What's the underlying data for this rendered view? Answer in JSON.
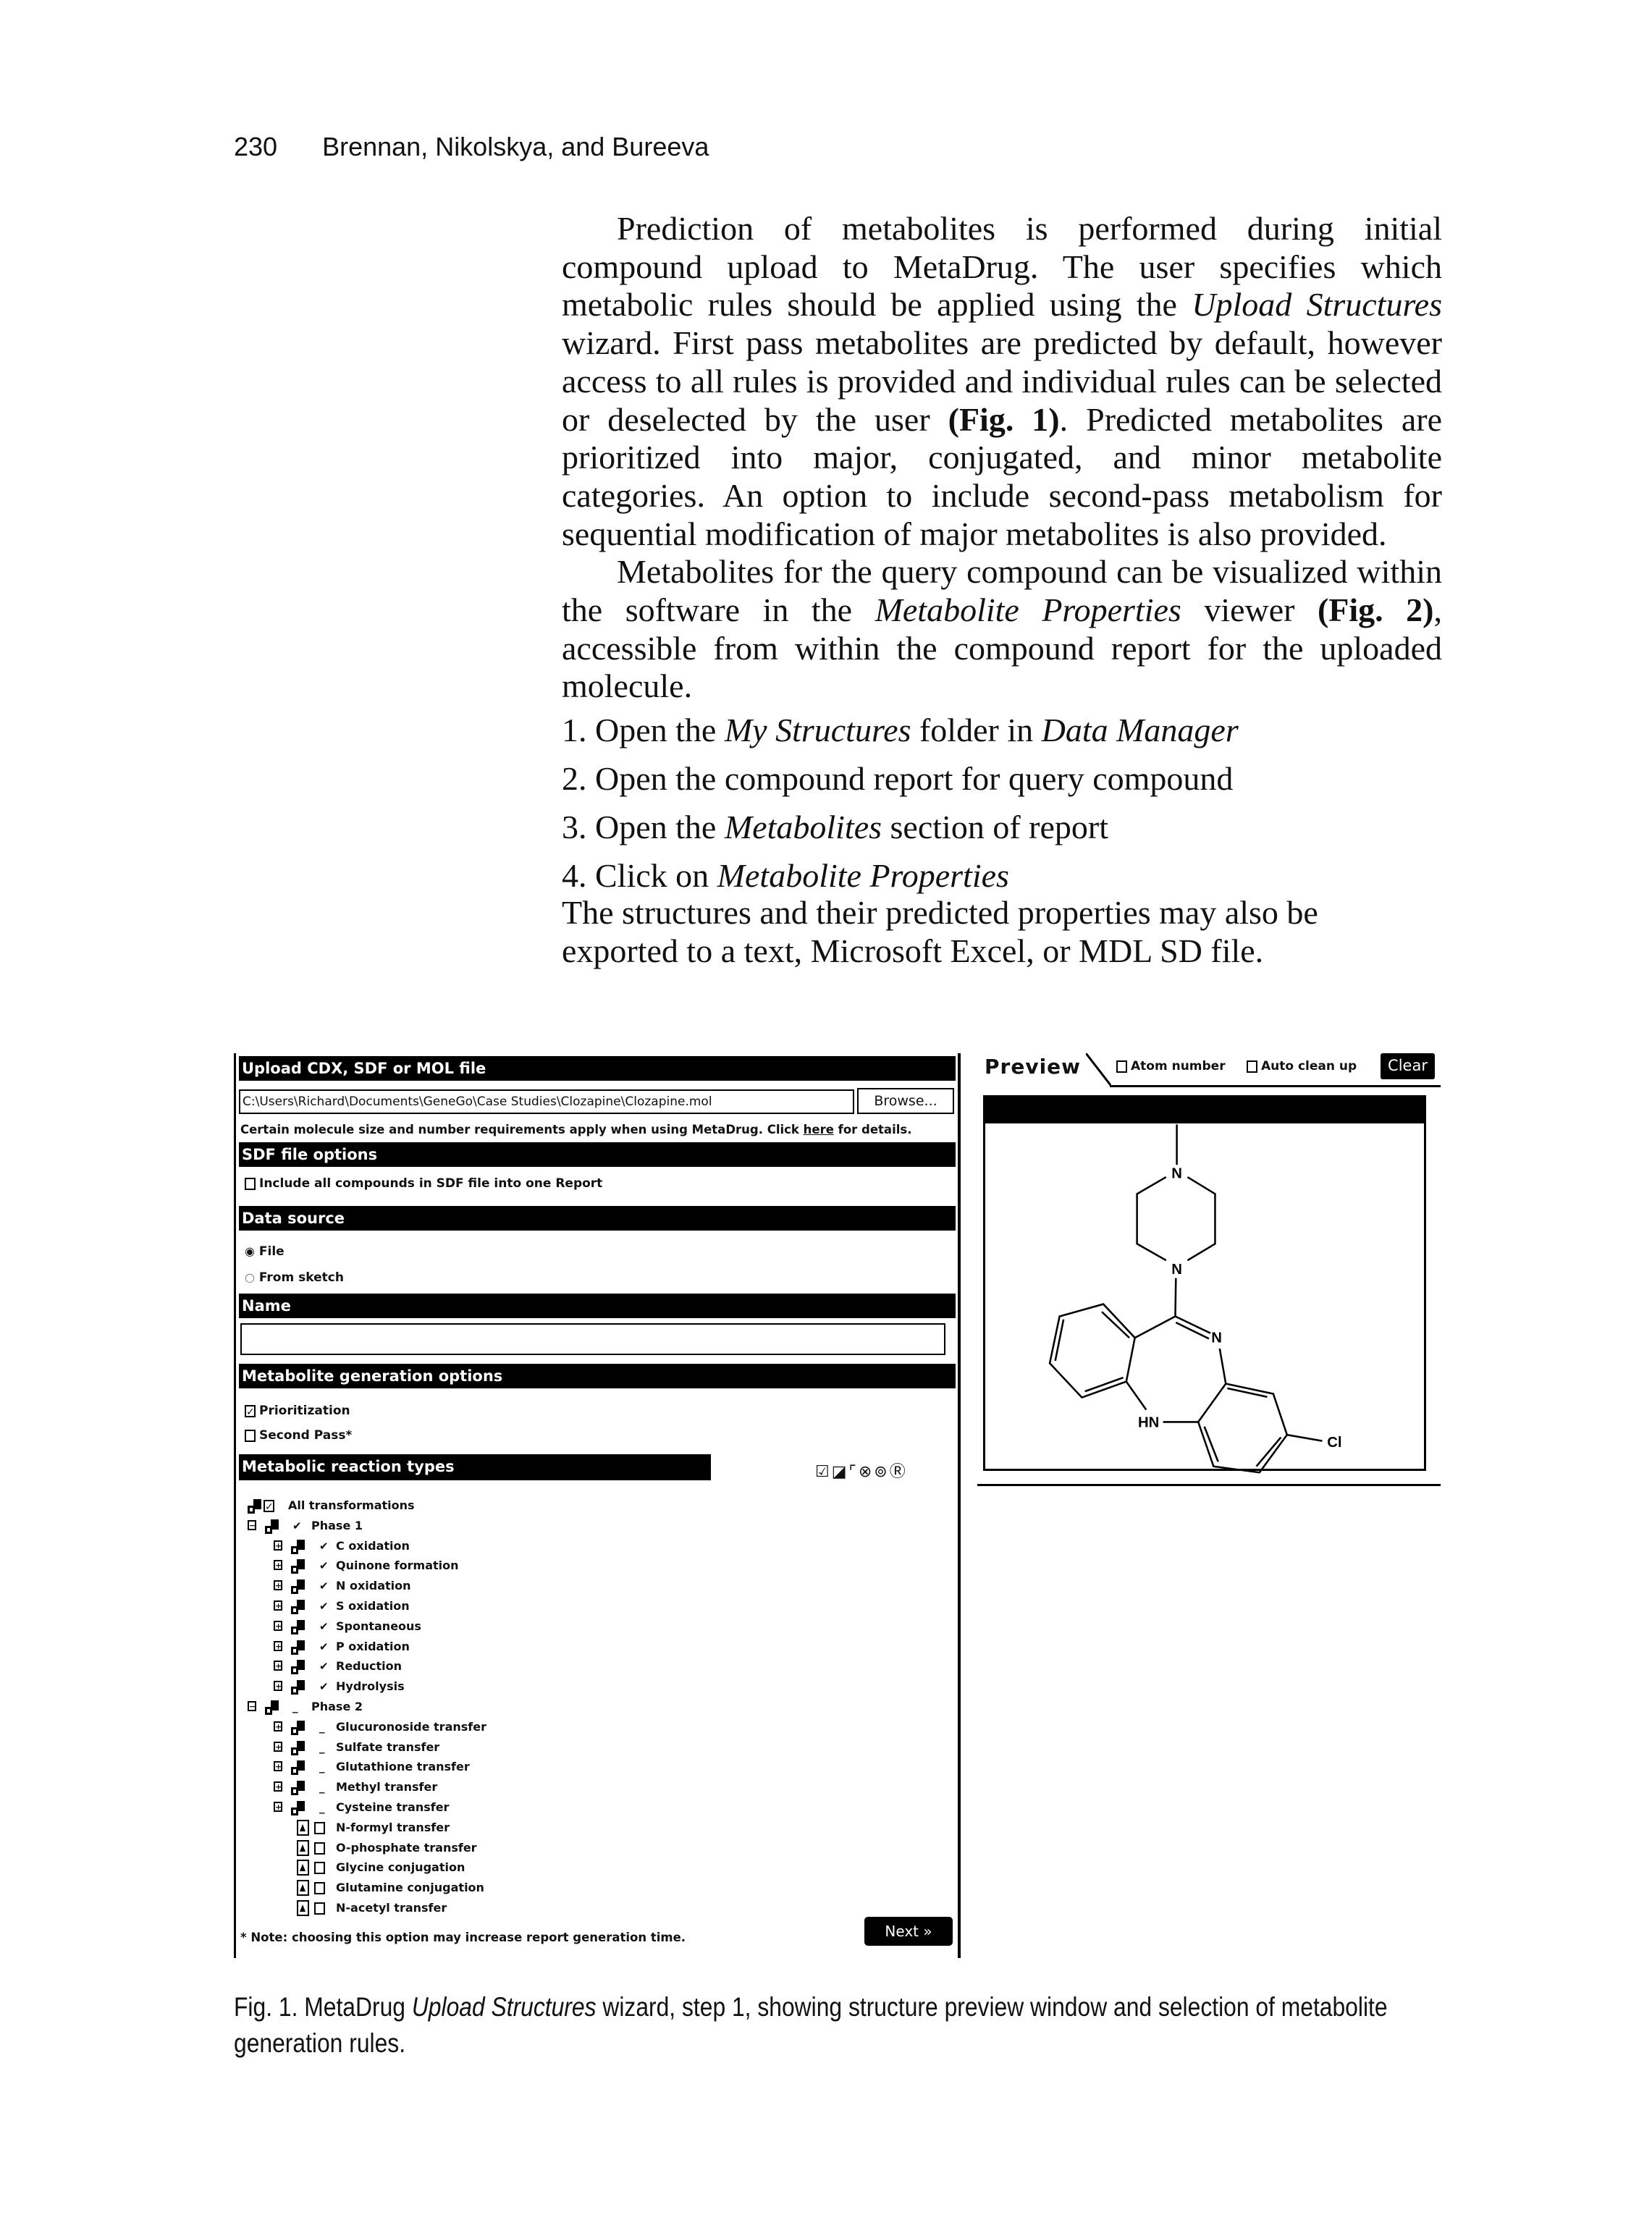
{
  "running_head": {
    "page_number": "230",
    "authors": "Brennan, Nikolskya, and Bureeva"
  },
  "body": {
    "p1": {
      "t1": "Prediction of metabolites is performed during initial compound upload to MetaDrug. The user specifies which metabolic rules should be applied using the ",
      "i1": "Upload Structures",
      "t2": " wizard. First pass metabolites are predicted by default, however access to all rules is provided and individual rules can be selected or deselected by the user ",
      "b1": "(Fig. 1)",
      "t3": ". Predicted metabolites are prioritized into major, conjugated, and minor metabolite categories. An option to include second-pass metabolism for sequential modification of major metabolites is also provided."
    },
    "p2": {
      "t1": "Metabolites for the query compound can be visualized within the software in the ",
      "i1": "Metabolite Properties",
      "t2": " viewer ",
      "b1": "(Fig. 2)",
      "t3": ", accessible from within the compound report for the uploaded molecule."
    },
    "steps": [
      {
        "pre": "1. Open the ",
        "em": "My Structures",
        "mid": " folder in ",
        "em2": "Data Manager"
      },
      {
        "pre": "2. Open the compound report for query compound",
        "em": "",
        "mid": "",
        "em2": ""
      },
      {
        "pre": "3. Open the ",
        "em": "Metabolites",
        "mid": " section of report",
        "em2": ""
      },
      {
        "pre": "4. Click on ",
        "em": "Metabolite Properties",
        "mid": "",
        "em2": ""
      }
    ],
    "p3": "The structures and their predicted properties may also be exported to a text, Microsoft Excel, or MDL SD file."
  },
  "wizard": {
    "upload_header": "Upload CDX, SDF or MOL file",
    "file_path": "C:\\Users\\Richard\\Documents\\GeneGo\\Case Studies\\Clozapine\\Clozapine.mol",
    "browse_label": "Browse...",
    "requirements_text": "Certain molecule size and number requirements apply when using MetaDrug. Click ",
    "here_link": "here",
    "requirements_tail": " for details.",
    "sdf_header": "SDF file options",
    "sdf_checkbox": "Include all compounds in SDF file into one Report",
    "data_source_header": "Data source",
    "radio_file": "File",
    "radio_sketch": "From sketch",
    "name_header": "Name",
    "name_value": "",
    "metabolite_header": "Metabolite generation options",
    "prioritization": "Prioritization",
    "second_pass": "Second Pass*",
    "reaction_header": "Metabolic reaction types",
    "tree": [
      {
        "label": "All transformations",
        "state": "checked"
      },
      {
        "label": "Phase 1",
        "state": "checked"
      },
      {
        "label": "C oxidation",
        "state": "checked"
      },
      {
        "label": "Quinone formation",
        "state": "checked"
      },
      {
        "label": "N oxidation",
        "state": "checked"
      },
      {
        "label": "S oxidation",
        "state": "checked"
      },
      {
        "label": "Spontaneous",
        "state": "checked"
      },
      {
        "label": "P oxidation",
        "state": "checked"
      },
      {
        "label": "Reduction",
        "state": "checked"
      },
      {
        "label": "Hydrolysis",
        "state": "checked"
      },
      {
        "label": "Phase 2",
        "state": "unchecked"
      },
      {
        "label": "Glucuronoside transfer",
        "state": "unchecked"
      },
      {
        "label": "Sulfate transfer",
        "state": "unchecked"
      },
      {
        "label": "Glutathione transfer",
        "state": "unchecked"
      },
      {
        "label": "Methyl transfer",
        "state": "unchecked"
      },
      {
        "label": "Cysteine transfer",
        "state": "unchecked"
      },
      {
        "label": "N-formyl transfer",
        "state": "unchecked"
      },
      {
        "label": "O-phosphate transfer",
        "state": "unchecked"
      },
      {
        "label": "Glycine conjugation",
        "state": "unchecked"
      },
      {
        "label": "Glutamine conjugation",
        "state": "unchecked"
      },
      {
        "label": "N-acetyl transfer",
        "state": "unchecked"
      }
    ],
    "note": "* Note: choosing this option may increase report generation time.",
    "next_label": "Next »"
  },
  "preview": {
    "tab_label": "Preview",
    "atom_number": "Atom number",
    "auto_clean": "Auto clean up",
    "clear_label": "Clear",
    "atoms": {
      "n1": "N",
      "n2": "N",
      "n3": "N",
      "hn": "HN",
      "cl": "Cl"
    }
  },
  "caption": {
    "prefix": "Fig. 1. MetaDrug ",
    "em": "Upload Structures",
    "rest": " wizard, step 1, showing structure preview window and selection of metabolite generation rules."
  }
}
